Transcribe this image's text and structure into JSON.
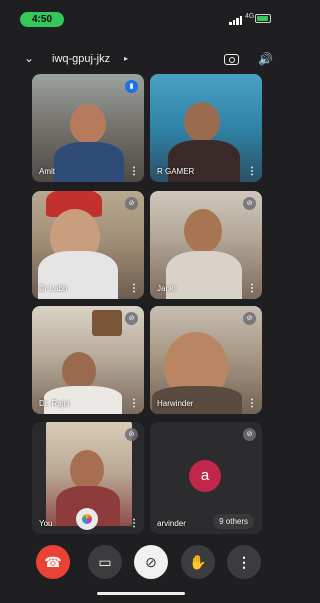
{
  "status_bar": {
    "time": "4:50",
    "network": "4G"
  },
  "header": {
    "meeting_code": "iwq-gpuj-jkz",
    "code_arrow": "▸"
  },
  "participants": [
    {
      "name": "Amit",
      "muted": false,
      "speaking": true
    },
    {
      "name": "R GAMER",
      "muted": false
    },
    {
      "name": "Dr Labh",
      "muted": true
    },
    {
      "name": "Janki",
      "muted": true
    },
    {
      "name": "Dr. Rajni",
      "muted": true
    },
    {
      "name": "Harwinder",
      "muted": true
    },
    {
      "name": "You",
      "muted": true
    },
    {
      "name": "arvinder",
      "initial": "a",
      "muted": true,
      "avatar_color": "#c0274a"
    }
  ],
  "others_label": "9 others",
  "controls": {
    "end_call": "end-call",
    "camera": "camera",
    "mic": "mic-muted",
    "hand": "raise-hand",
    "more": "more-options"
  },
  "colors": {
    "end_call": "#ea4335",
    "speaking": "#1a73e8",
    "status_pill": "#34c759"
  }
}
